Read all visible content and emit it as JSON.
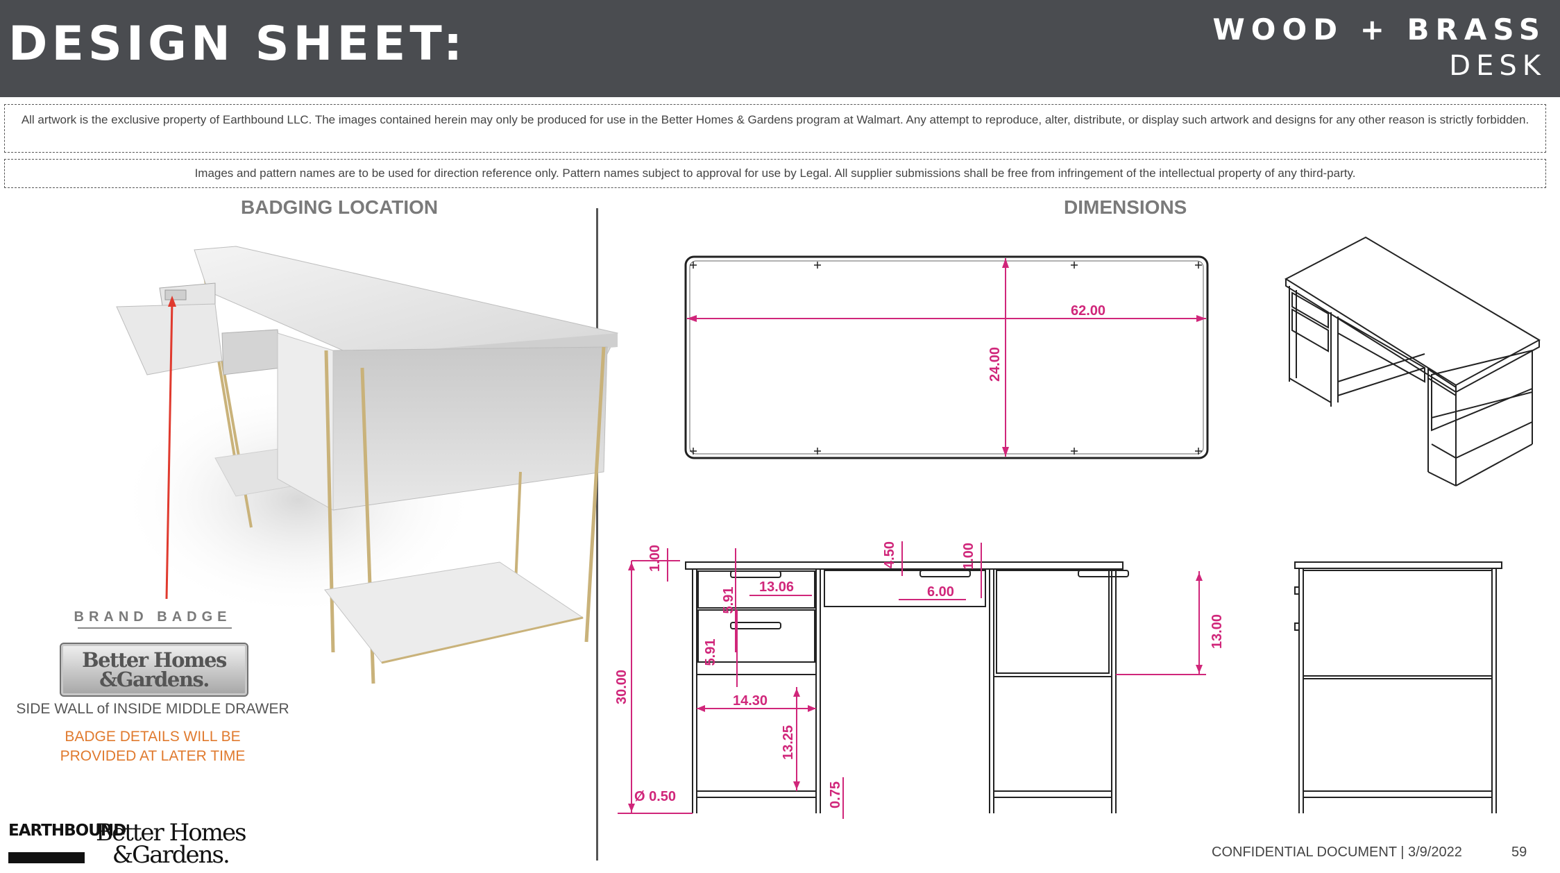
{
  "header": {
    "title": "DESIGN SHEET:",
    "product_line1": "WOOD + BRASS",
    "product_line2": "DESK"
  },
  "notices": [
    "All artwork is the exclusive property of Earthbound LLC. The images contained herein may only be produced for use in the Better Homes & Gardens program at Walmart. Any attempt to reproduce, alter, distribute, or display such artwork and designs for any other reason is strictly forbidden.",
    "Images and pattern names are to be used for direction reference only.  Pattern names subject to approval for use by Legal. All supplier submissions shall be free from infringement of the intellectual property of any third-party."
  ],
  "badging": {
    "section_title": "BADGING LOCATION",
    "brand_badge_label": "BRAND BADGE",
    "badge_line1": "Better Homes",
    "badge_line2": "&Gardens.",
    "location": "SIDE WALL of INSIDE MIDDLE DRAWER",
    "note_line1": "BADGE DETAILS WILL BE",
    "note_line2": "PROVIDED AT LATER TIME"
  },
  "dimensions": {
    "section_title": "DIMENSIONS",
    "top_view": {
      "width": "62.00",
      "depth": "24.00"
    },
    "front_view": {
      "top_thickness": "1.00",
      "apron_height": "4.50",
      "middle_drawer_gap": "1.00",
      "drawer_width": "13.06",
      "drawer_height_upper": "5.91",
      "drawer_height_lower": "5.91",
      "pull_width": "6.00",
      "right_drawer_height": "13.00",
      "total_height": "30.00",
      "cabinet_width": "14.30",
      "shelf_height": "13.25",
      "shelf_thickness": "0.75",
      "leg_diameter": "Ø 0.50"
    }
  },
  "footer": {
    "brand_left": "EARTHBOUND",
    "brand_right_line1": "Better Homes",
    "brand_right_line2": "&Gardens.",
    "confidential": "CONFIDENTIAL DOCUMENT | 3/9/2022",
    "page_number": "59"
  },
  "colors": {
    "header_bg": "#4a4c50",
    "dimension": "#d0267a",
    "note": "#e07a2e",
    "pointer": "#e03a2e"
  }
}
